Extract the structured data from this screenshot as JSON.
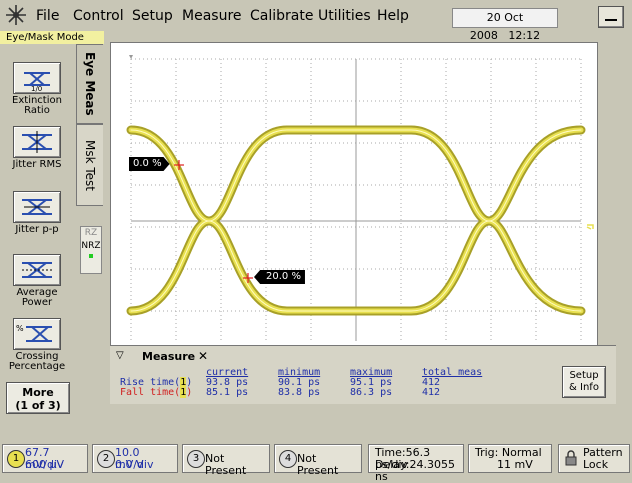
{
  "menubar": {
    "items": [
      "File",
      "Control",
      "Setup",
      "Measure",
      "Calibrate",
      "Utilities",
      "Help"
    ],
    "date": "20 Oct 2008",
    "time": "12:12"
  },
  "mode_label": "Eye/Mask Mode",
  "left_buttons": [
    {
      "label": "Extinction Ratio",
      "icon": "extinction-ratio-icon"
    },
    {
      "label": "Jitter RMS",
      "icon": "jitter-rms-icon"
    },
    {
      "label": "Jitter p-p",
      "icon": "jitter-pp-icon"
    },
    {
      "label": "Average Power",
      "icon": "average-power-icon"
    },
    {
      "label": "Crossing Percentage",
      "icon": "crossing-percentage-icon"
    }
  ],
  "more_button": {
    "line1": "More",
    "line2": "(1 of 3)"
  },
  "tabs": {
    "eye_meas": "Eye Meas",
    "msk_test": "Msk Test"
  },
  "rz_nrz": {
    "rz": "RZ",
    "nrz": "NRZ"
  },
  "markers": {
    "upper": "0.0 %",
    "lower": "20.0 %"
  },
  "colors": {
    "trace": "#e8e050",
    "trace_dark": "#a8a028",
    "marker": "#e02020",
    "current_blue": "#1f2fa8",
    "fall_red": "#d02020"
  },
  "measure_panel": {
    "title": "Measure",
    "headers": {
      "current": "current",
      "minimum": "minimum",
      "maximum": "maximum",
      "total": "total meas"
    },
    "rows": [
      {
        "label": "Rise time(",
        "ch": "1",
        "close": ")",
        "current": "93.8 ps",
        "minimum": "90.1 ps",
        "maximum": "95.1 ps",
        "total": "412"
      },
      {
        "label": "Fall time(",
        "ch": "1",
        "close": ")",
        "current": "85.1 ps",
        "minimum": "83.8 ps",
        "maximum": "86.3 ps",
        "total": "412"
      }
    ],
    "setup_info": {
      "line1": "Setup",
      "line2": "& Info"
    }
  },
  "status": {
    "ch1": {
      "num": "1",
      "scale": "67.7 mV/div",
      "offset": "600 µV"
    },
    "ch2": {
      "num": "2",
      "scale": "10.0 mV/div",
      "offset": "0.0 V"
    },
    "ch3": {
      "num": "3",
      "text": "Not Present"
    },
    "ch4": {
      "num": "4",
      "text": "Not Present"
    },
    "timebase": {
      "time": "Time:56.3 ps/div",
      "delay": "Delay:24.3055 ns"
    },
    "trigger": {
      "mode": "Trig: Normal",
      "level": "11 mV"
    },
    "pattern_lock": {
      "line1": "Pattern",
      "line2": "Lock"
    }
  }
}
